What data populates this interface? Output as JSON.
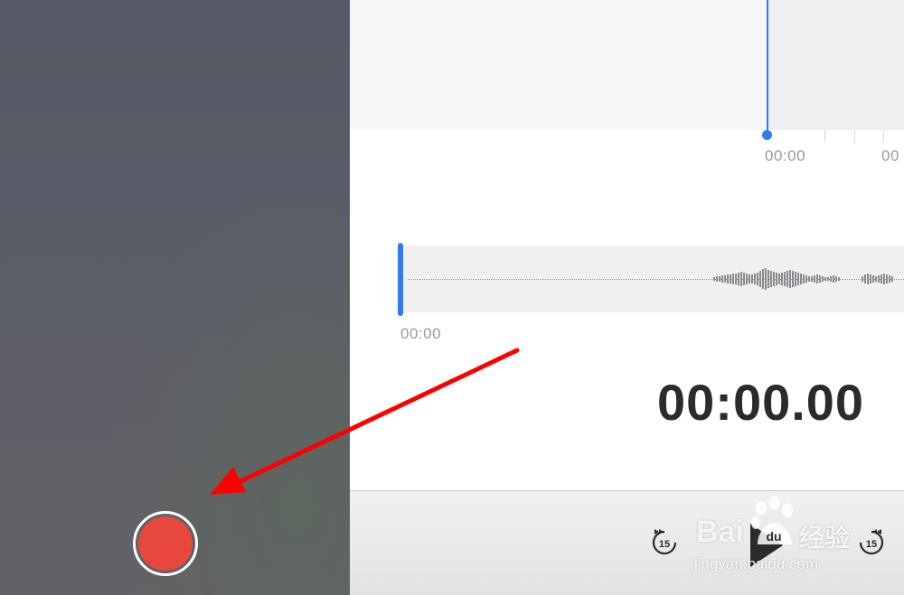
{
  "recorder": {
    "elapsed_time": "00:00.00",
    "overview_time_labels": [
      "00:00",
      "00"
    ],
    "detail_time_label": "00:00",
    "skip_back_seconds": "15",
    "skip_forward_seconds": "15"
  },
  "watermark": {
    "brand": "Bai",
    "brand_cn": "经验",
    "url": "jingyan.baidu.com"
  },
  "colors": {
    "record": "#e8473d",
    "accent": "#2f7bf0",
    "annotation_arrow": "#ff0000"
  },
  "icons": [
    "record-icon",
    "play-icon",
    "skip-back-15-icon",
    "skip-forward-15-icon",
    "baidu-paw-icon"
  ]
}
